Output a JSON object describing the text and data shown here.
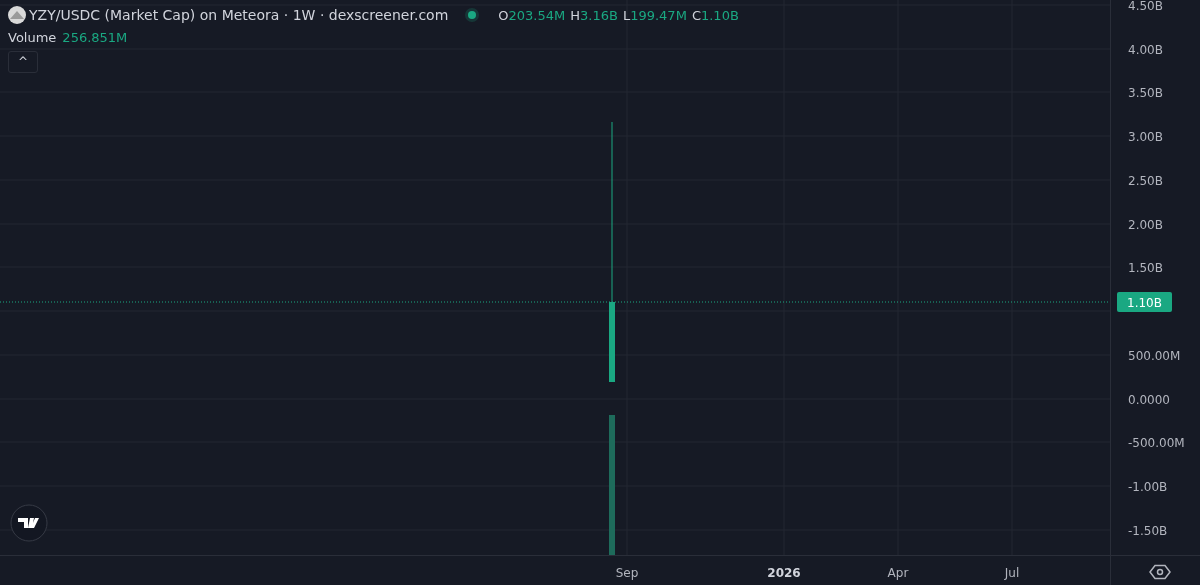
{
  "legend": {
    "title": "YZY/USDC (Market Cap) on Meteora · 1W · dexscreener.com",
    "market_open": true,
    "ohlc": [
      {
        "label": "O",
        "value": "203.54M"
      },
      {
        "label": "H",
        "value": "3.16B"
      },
      {
        "label": "L",
        "value": "199.47M"
      },
      {
        "label": "C",
        "value": "1.10B"
      }
    ],
    "volume": {
      "label": "Volume",
      "value": "256.851M"
    },
    "collapse_button": "^"
  },
  "chart": {
    "kind": "candlestick",
    "last_price_label": "1.10B",
    "price_axis": [
      "4.50B",
      "4.00B",
      "3.50B",
      "3.00B",
      "2.50B",
      "2.00B",
      "1.50B",
      "500.00M",
      "0.0000",
      "-500.00M",
      "-1.00B",
      "-1.50B"
    ],
    "time_axis": [
      {
        "label": "Sep",
        "kind": "month"
      },
      {
        "label": "2026",
        "kind": "year"
      },
      {
        "label": "Apr",
        "kind": "month"
      },
      {
        "label": "Jul",
        "kind": "month"
      }
    ]
  }
}
